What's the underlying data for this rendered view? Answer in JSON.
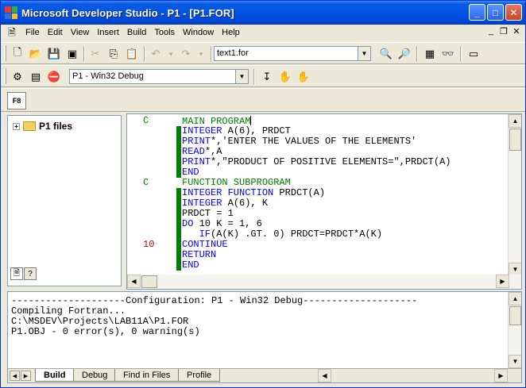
{
  "window": {
    "title": "Microsoft Developer Studio - P1 - [P1.FOR]",
    "controls": {
      "minimize": "_",
      "maximize": "□",
      "close": "✕"
    },
    "mdi_controls": {
      "minimize": "_",
      "restore": "❐",
      "close": "✕"
    }
  },
  "menu": {
    "items": [
      "File",
      "Edit",
      "View",
      "Insert",
      "Build",
      "Tools",
      "Window",
      "Help"
    ]
  },
  "toolbar": {
    "find_combo_value": "text1.for",
    "config_combo_value": "P1 - Win32 Debug",
    "small_button_label": "F8"
  },
  "workspace": {
    "root_label": "P1 files",
    "tab_icons": [
      "file-view-icon",
      "info-view-icon"
    ]
  },
  "editor": {
    "lines": [
      {
        "label": "C",
        "code": "MAIN PROGRAM",
        "style": "comment",
        "cursor": true
      },
      {
        "label": "",
        "code": "INTEGER A(6), PRDCT",
        "style": "code"
      },
      {
        "label": "",
        "code": "PRINT*,'ENTER THE VALUES OF THE ELEMENTS'",
        "style": "code"
      },
      {
        "label": "",
        "code": "READ*,A",
        "style": "code"
      },
      {
        "label": "",
        "code": "PRINT*,\"PRODUCT OF POSITIVE ELEMENTS=\",PRDCT(A)",
        "style": "code"
      },
      {
        "label": "",
        "code": "END",
        "style": "code"
      },
      {
        "label": "C",
        "code": "FUNCTION SUBPROGRAM",
        "style": "comment"
      },
      {
        "label": "",
        "code": "INTEGER FUNCTION PRDCT(A)",
        "style": "code"
      },
      {
        "label": "",
        "code": "INTEGER A(6), K",
        "style": "code"
      },
      {
        "label": "",
        "code": "PRDCT = 1",
        "style": "code"
      },
      {
        "label": "",
        "code": "DO 10 K = 1, 6",
        "style": "code"
      },
      {
        "label": "",
        "code": "   IF(A(K) .GT. 0) PRDCT=PRDCT*A(K)",
        "style": "code"
      },
      {
        "label": "10",
        "code": "CONTINUE",
        "style": "code"
      },
      {
        "label": "",
        "code": "RETURN",
        "style": "code"
      },
      {
        "label": "",
        "code": "END",
        "style": "code"
      }
    ]
  },
  "output": {
    "lines": [
      "--------------------Configuration: P1 - Win32 Debug--------------------",
      "Compiling Fortran...",
      "C:\\MSDEV\\Projects\\LAB11A\\P1.FOR",
      "P1.OBJ - 0 error(s), 0 warning(s)"
    ],
    "tabs": [
      "Build",
      "Debug",
      "Find in Files",
      "Profile"
    ],
    "active_tab": "Build"
  }
}
